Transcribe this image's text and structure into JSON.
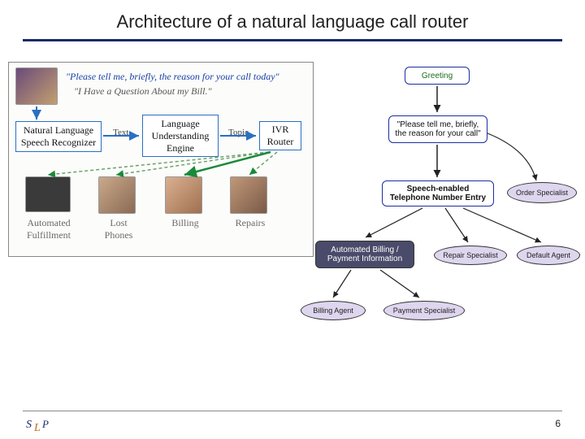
{
  "title": "Architecture of a natural language call router",
  "page_number": "6",
  "left": {
    "prompt": "\"Please tell me, briefly, the reason for your call today\"",
    "reply": "\"I Have a Question About my Bill.\"",
    "box_nlsr": "Natural Language\nSpeech Recognizer",
    "box_lue": "Language\nUnderstanding\nEngine",
    "box_ivr": "IVR\nRouter",
    "label_text": "Text",
    "label_topic": "Topic",
    "cap_auto": "Automated\nFulfillment",
    "cap_lost": "Lost\nPhones",
    "cap_billing": "Billing",
    "cap_repairs": "Repairs"
  },
  "flow": {
    "greeting": "Greeting",
    "prompt": "\"Please tell me, briefly,\nthe reason for your call\"",
    "sne": "Speech-enabled\nTelephone Number Entry",
    "order": "Order Specialist",
    "abi": "Automated Billing /\nPayment Information",
    "repair": "Repair Specialist",
    "default": "Default Agent",
    "billing": "Billing Agent",
    "payment": "Payment Specialist"
  }
}
